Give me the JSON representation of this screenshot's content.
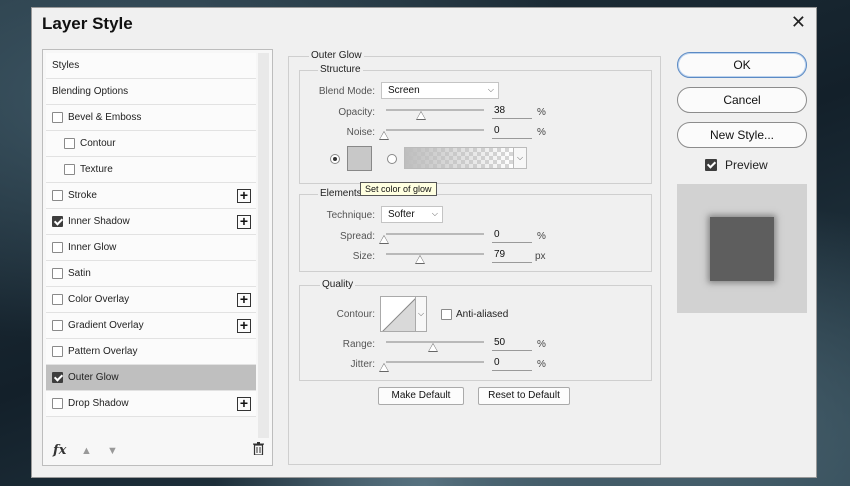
{
  "dialog": {
    "title": "Layer Style",
    "close_glyph": "✕"
  },
  "styles_panel": {
    "items": [
      {
        "label": "Styles",
        "checkbox": false,
        "checked": false,
        "plus": false,
        "selected": false
      },
      {
        "label": "Blending Options",
        "checkbox": false,
        "checked": false,
        "plus": false,
        "selected": false
      },
      {
        "label": "Bevel & Emboss",
        "checkbox": true,
        "checked": false,
        "plus": false,
        "selected": false
      },
      {
        "label": "Contour",
        "checkbox": true,
        "checked": false,
        "plus": false,
        "selected": false,
        "indent": true
      },
      {
        "label": "Texture",
        "checkbox": true,
        "checked": false,
        "plus": false,
        "selected": false,
        "indent": true
      },
      {
        "label": "Stroke",
        "checkbox": true,
        "checked": false,
        "plus": true,
        "selected": false
      },
      {
        "label": "Inner Shadow",
        "checkbox": true,
        "checked": true,
        "plus": true,
        "selected": false
      },
      {
        "label": "Inner Glow",
        "checkbox": true,
        "checked": false,
        "plus": false,
        "selected": false
      },
      {
        "label": "Satin",
        "checkbox": true,
        "checked": false,
        "plus": false,
        "selected": false
      },
      {
        "label": "Color Overlay",
        "checkbox": true,
        "checked": false,
        "plus": true,
        "selected": false
      },
      {
        "label": "Gradient Overlay",
        "checkbox": true,
        "checked": false,
        "plus": true,
        "selected": false
      },
      {
        "label": "Pattern Overlay",
        "checkbox": true,
        "checked": false,
        "plus": false,
        "selected": false
      },
      {
        "label": "Outer Glow",
        "checkbox": true,
        "checked": true,
        "plus": false,
        "selected": true
      },
      {
        "label": "Drop Shadow",
        "checkbox": true,
        "checked": false,
        "plus": true,
        "selected": false
      }
    ],
    "footer": {
      "fx_label": "fx",
      "up_glyph": "▲",
      "down_glyph": "▼"
    }
  },
  "outer_glow": {
    "title": "Outer Glow",
    "structure": {
      "title": "Structure",
      "blend_mode_label": "Blend Mode:",
      "blend_mode_value": "Screen",
      "opacity_label": "Opacity:",
      "opacity_value": "38",
      "noise_label": "Noise:",
      "noise_value": "0",
      "percent_unit": "%",
      "swatch_color": "#c8c8c8",
      "tooltip": "Set color of glow"
    },
    "elements": {
      "title": "Elements",
      "technique_label": "Technique:",
      "technique_value": "Softer",
      "spread_label": "Spread:",
      "spread_value": "0",
      "size_label": "Size:",
      "size_value": "79",
      "percent_unit": "%",
      "px_unit": "px"
    },
    "quality": {
      "title": "Quality",
      "contour_label": "Contour:",
      "anti_aliased_label": "Anti-aliased",
      "range_label": "Range:",
      "range_value": "50",
      "jitter_label": "Jitter:",
      "jitter_value": "0",
      "percent_unit": "%"
    },
    "make_default": "Make Default",
    "reset_default": "Reset to Default"
  },
  "actions": {
    "ok": "OK",
    "cancel": "Cancel",
    "new_style": "New Style...",
    "preview_label": "Preview",
    "preview_checked": true
  },
  "dropdown_glyph": "⌵"
}
